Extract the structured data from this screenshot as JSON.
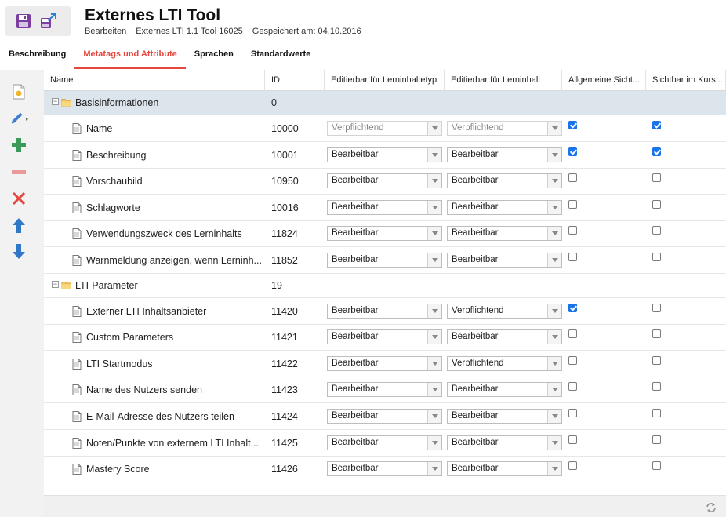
{
  "header": {
    "title": "Externes LTI Tool",
    "mode": "Bearbeiten",
    "type": "Externes LTI 1.1 Tool 16025",
    "saved": "Gespeichert am: 04.10.2016"
  },
  "tabs": [
    {
      "label": "Beschreibung",
      "active": false
    },
    {
      "label": "Metatags und Attribute",
      "active": true
    },
    {
      "label": "Sprachen",
      "active": false
    },
    {
      "label": "Standardwerte",
      "active": false
    }
  ],
  "columns": [
    "Name",
    "ID",
    "Editierbar für Lerninhaltetyp",
    "Editierbar für Lerninhalt",
    "Allgemeine Sicht...",
    "Sichtbar im Kurs..."
  ],
  "groups": [
    {
      "name": "Basisinformationen",
      "id": "0",
      "toggle": "−",
      "rows": [
        {
          "name": "Name",
          "id": "10000",
          "type_edit": "Verpflichtend",
          "content_edit": "Verpflichtend",
          "disabled": true,
          "general": true,
          "course": true
        },
        {
          "name": "Beschreibung",
          "id": "10001",
          "type_edit": "Bearbeitbar",
          "content_edit": "Bearbeitbar",
          "disabled": false,
          "general": true,
          "course": true
        },
        {
          "name": "Vorschaubild",
          "id": "10950",
          "type_edit": "Bearbeitbar",
          "content_edit": "Bearbeitbar",
          "disabled": false,
          "general": false,
          "course": false
        },
        {
          "name": "Schlagworte",
          "id": "10016",
          "type_edit": "Bearbeitbar",
          "content_edit": "Bearbeitbar",
          "disabled": false,
          "general": false,
          "course": false
        },
        {
          "name": "Verwendungszweck des Lerninhalts",
          "id": "11824",
          "type_edit": "Bearbeitbar",
          "content_edit": "Bearbeitbar",
          "disabled": false,
          "general": false,
          "course": false
        },
        {
          "name": "Warnmeldung anzeigen, wenn Lerninh...",
          "id": "11852",
          "type_edit": "Bearbeitbar",
          "content_edit": "Bearbeitbar",
          "disabled": false,
          "general": false,
          "course": false
        }
      ]
    },
    {
      "name": "LTI-Parameter",
      "id": "19",
      "toggle": "−",
      "rows": [
        {
          "name": "Externer LTI Inhaltsanbieter",
          "id": "11420",
          "type_edit": "Bearbeitbar",
          "content_edit": "Verpflichtend",
          "disabled": false,
          "general": true,
          "course": false
        },
        {
          "name": "Custom Parameters",
          "id": "11421",
          "type_edit": "Bearbeitbar",
          "content_edit": "Bearbeitbar",
          "disabled": false,
          "general": false,
          "course": false
        },
        {
          "name": "LTI Startmodus",
          "id": "11422",
          "type_edit": "Bearbeitbar",
          "content_edit": "Verpflichtend",
          "disabled": false,
          "general": false,
          "course": false
        },
        {
          "name": "Name des Nutzers senden",
          "id": "11423",
          "type_edit": "Bearbeitbar",
          "content_edit": "Bearbeitbar",
          "disabled": false,
          "general": false,
          "course": false
        },
        {
          "name": "E-Mail-Adresse des Nutzers teilen",
          "id": "11424",
          "type_edit": "Bearbeitbar",
          "content_edit": "Bearbeitbar",
          "disabled": false,
          "general": false,
          "course": false
        },
        {
          "name": "Noten/Punkte von externem LTI Inhalt...",
          "id": "11425",
          "type_edit": "Bearbeitbar",
          "content_edit": "Bearbeitbar",
          "disabled": false,
          "general": false,
          "course": false
        },
        {
          "name": "Mastery Score",
          "id": "11426",
          "type_edit": "Bearbeitbar",
          "content_edit": "Bearbeitbar",
          "disabled": false,
          "general": false,
          "course": false
        }
      ]
    }
  ],
  "colors": {
    "accent": "#e4473f",
    "selected_row": "#dde5ec",
    "checkbox": "#1a73e8"
  }
}
